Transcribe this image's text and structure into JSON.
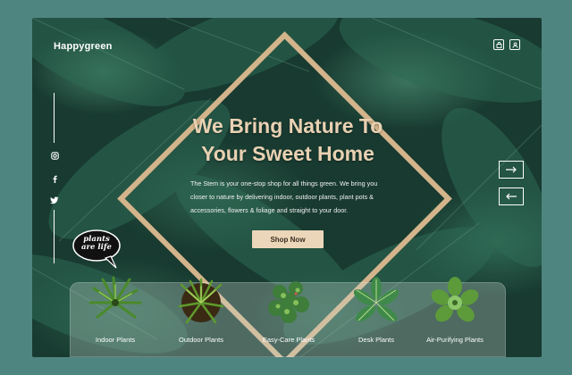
{
  "brand": "Happygreen",
  "header": {
    "icons": [
      "shopping-bag-icon",
      "user-icon"
    ]
  },
  "social": [
    "instagram-icon",
    "facebook-icon",
    "twitter-icon"
  ],
  "hero": {
    "title_line1": "We Bring Nature To",
    "title_line2": "Your Sweet Home",
    "desc_line1": "The Stem is your one-stop shop for all things green. We bring you",
    "desc_line2": "closer to nature by delivering indoor, outdoor plants, plant pots &",
    "desc_line3": "accessories, flowers & foliage and straight to your door.",
    "cta": "Shop Now"
  },
  "badge": {
    "line1": "plants",
    "line2": "are life"
  },
  "colors": {
    "accent": "#d3b48b",
    "button": "#ecd6b9",
    "background": "#4f8580",
    "hero_dark": "#183a30"
  },
  "categories": [
    {
      "label": "Indoor Plants"
    },
    {
      "label": "Outdoor Plants"
    },
    {
      "label": "Easy-Care Plants"
    },
    {
      "label": "Desk Plants"
    },
    {
      "label": "Air-Purifying Plants"
    }
  ]
}
